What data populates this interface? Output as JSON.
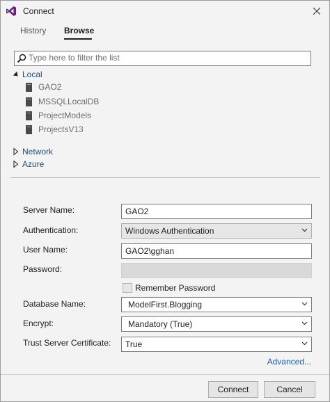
{
  "window": {
    "title": "Connect"
  },
  "tabs": [
    {
      "label": "History",
      "selected": false
    },
    {
      "label": "Browse",
      "selected": true
    }
  ],
  "filter": {
    "placeholder": "Type here to filter the list",
    "value": ""
  },
  "tree": {
    "local": {
      "label": "Local",
      "expanded": true,
      "servers": [
        "GAO2",
        "MSSQLLocalDB",
        "ProjectModels",
        "ProjectsV13"
      ]
    },
    "network": {
      "label": "Network",
      "expanded": false
    },
    "azure": {
      "label": "Azure",
      "expanded": false
    }
  },
  "form": {
    "server_name": {
      "label": "Server Name:",
      "value": "GAO2"
    },
    "authentication": {
      "label": "Authentication:",
      "value": "Windows Authentication"
    },
    "user_name": {
      "label": "User Name:",
      "value": "GAO2\\gghan"
    },
    "password": {
      "label": "Password:",
      "value": ""
    },
    "remember_password": {
      "label": "Remember Password",
      "checked": false
    },
    "database_name": {
      "label": "Database Name:",
      "value": "ModelFirst.Blogging"
    },
    "encrypt": {
      "label": "Encrypt:",
      "value": "Mandatory (True)"
    },
    "trust_server_certificate": {
      "label": "Trust Server Certificate:",
      "value": "True"
    },
    "advanced_label": "Advanced..."
  },
  "buttons": {
    "connect": "Connect",
    "cancel": "Cancel"
  },
  "colors": {
    "tree_header": "#1f4e79",
    "link": "#1a5fb4",
    "vs_purple": "#68217a"
  },
  "icons": {
    "app": "visual-studio-icon",
    "search": "search-icon",
    "server": "server-icon",
    "expanded": "triangle-down-icon",
    "collapsed": "triangle-right-icon",
    "dropdown": "chevron-down-icon",
    "close": "close-icon"
  }
}
